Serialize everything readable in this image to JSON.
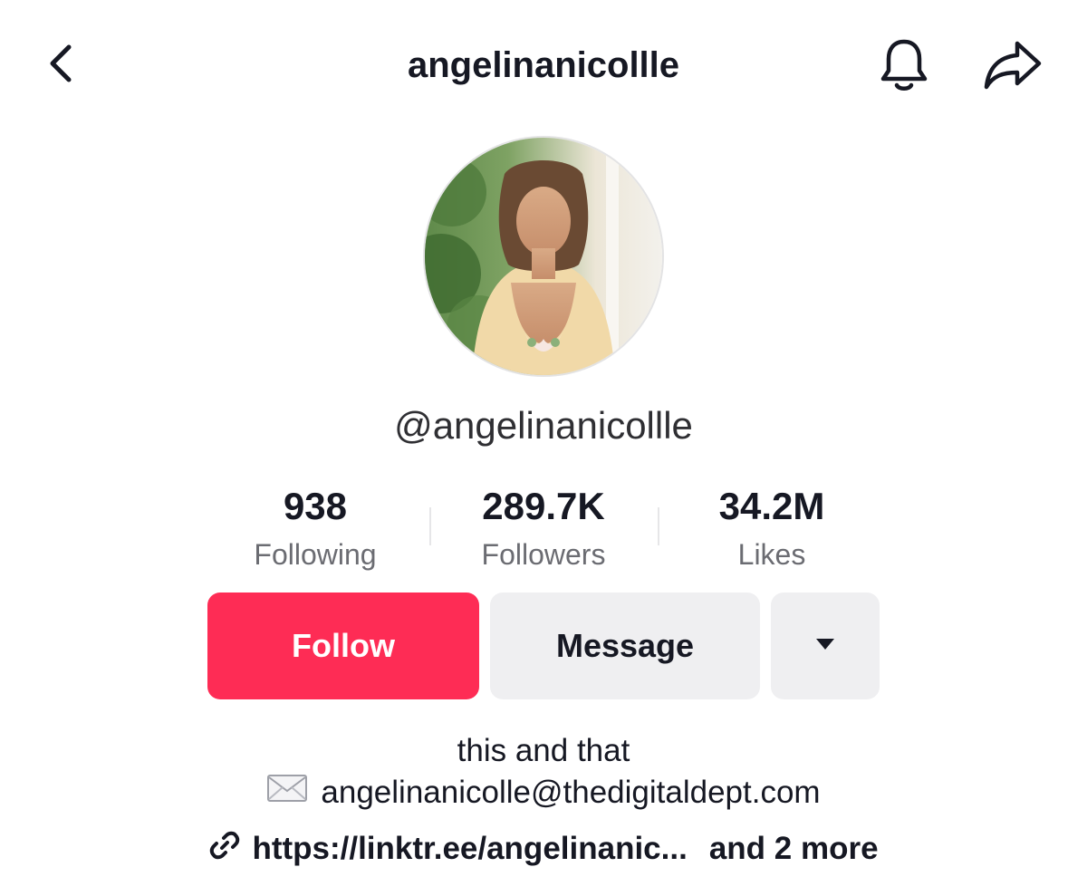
{
  "header": {
    "title": "angelinanicollle",
    "back_icon": "chevron-left-icon",
    "bell_icon": "bell-icon",
    "share_icon": "share-arrow-icon"
  },
  "profile": {
    "handle": "@angelinanicollle",
    "avatar": "profile-photo"
  },
  "stats": [
    {
      "value": "938",
      "label": "Following"
    },
    {
      "value": "289.7K",
      "label": "Followers"
    },
    {
      "value": "34.2M",
      "label": "Likes"
    }
  ],
  "actions": {
    "follow_label": "Follow",
    "message_label": "Message",
    "more_icon": "caret-down-icon"
  },
  "bio": {
    "line1": "this and that",
    "email_icon": "envelope-icon",
    "email": "angelinanicolle@thedigitaldept.com",
    "link_icon": "link-icon",
    "link_text": "https://linktr.ee/angelinanic...",
    "more_links": "and 2 more"
  },
  "colors": {
    "follow": "#fe2c55",
    "secondary_button": "#efeff1",
    "text": "#161823",
    "muted_text": "#6b6c72"
  }
}
